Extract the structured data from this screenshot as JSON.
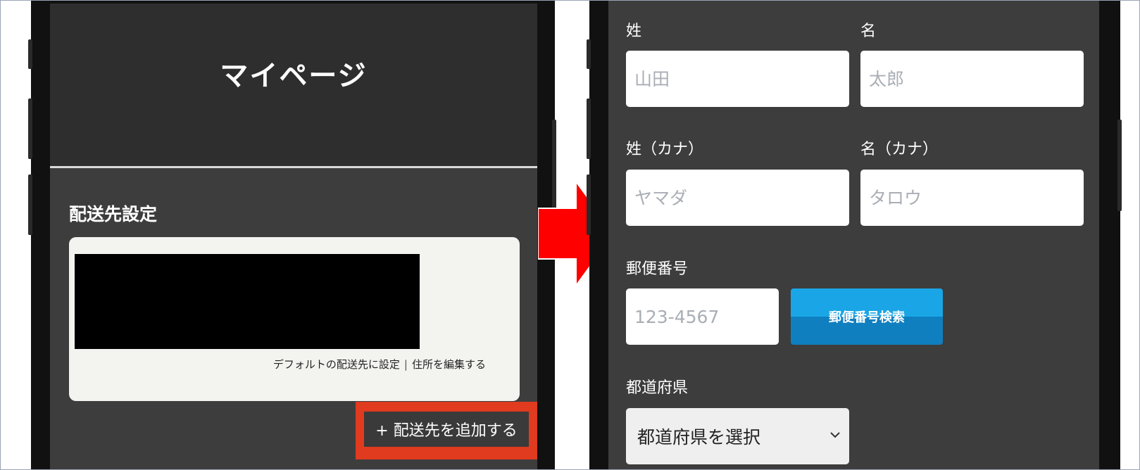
{
  "left": {
    "page_title": "マイページ",
    "section_title": "配送先設定",
    "card": {
      "default_link": "デフォルトの配送先に設定",
      "separator": "|",
      "edit_link": "住所を編集する"
    },
    "add_button": "+ 配送先を追加する"
  },
  "right": {
    "labels": {
      "last_name": "姓",
      "first_name": "名",
      "last_name_kana": "姓（カナ）",
      "first_name_kana": "名（カナ）",
      "postal_code": "郵便番号",
      "prefecture": "都道府県"
    },
    "placeholders": {
      "last_name": "山田",
      "first_name": "太郎",
      "last_name_kana": "ヤマダ",
      "first_name_kana": "タロウ",
      "postal_code": "123-4567"
    },
    "postal_search_button": "郵便番号検索",
    "prefecture_select": "都道府県を選択"
  },
  "colors": {
    "highlight_border": "#e03a1f",
    "arrow": "#ff0000",
    "search_button_top": "#1aa6e6",
    "search_button_bottom": "#0f7fc0",
    "screen_background": "#3d3d3d"
  },
  "icons": {
    "transition": "right-arrow-icon",
    "select": "chevron-down-icon"
  }
}
